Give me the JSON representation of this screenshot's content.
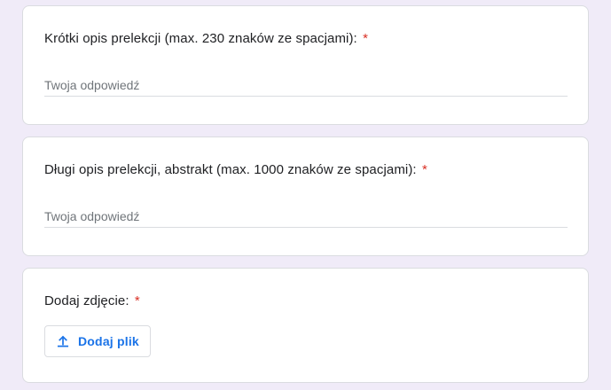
{
  "colors": {
    "page_background": "#f0ebf8",
    "card_background": "#ffffff",
    "required": "#d93025",
    "accent": "#1a73e8",
    "text": "#202124",
    "placeholder": "#70757a"
  },
  "questions": [
    {
      "title": "Krótki opis prelekcji (max. 230 znaków ze spacjami):",
      "required_mark": "*",
      "placeholder": "Twoja odpowiedź",
      "value": ""
    },
    {
      "title": "Długi opis prelekcji, abstrakt (max. 1000 znaków ze spacjami):",
      "required_mark": "*",
      "placeholder": "Twoja odpowiedź",
      "value": ""
    },
    {
      "title": "Dodaj zdjęcie:",
      "required_mark": "*",
      "upload_button_label": "Dodaj plik",
      "upload_icon": "upload-icon"
    }
  ]
}
